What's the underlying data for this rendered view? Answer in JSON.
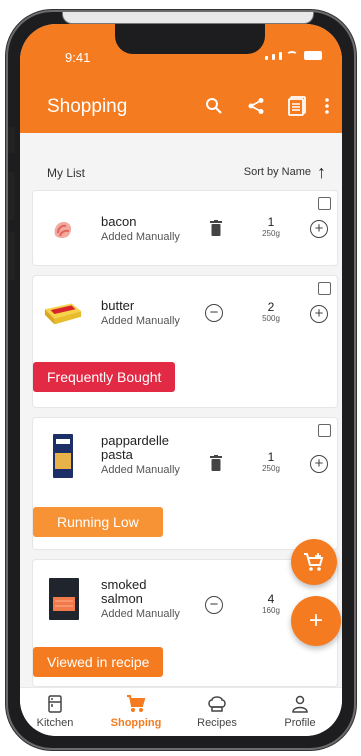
{
  "status": {
    "time": "9:41"
  },
  "app": {
    "title": "Shopping"
  },
  "list": {
    "name": "My List",
    "sort_label": "Sort by Name"
  },
  "items": [
    {
      "name": "bacon",
      "subtitle": "Added Manually",
      "quantity": "1",
      "unit": "250g",
      "tag": ""
    },
    {
      "name": "butter",
      "subtitle": "Added Manually",
      "quantity": "2",
      "unit": "500g",
      "tag": "Frequently Bought"
    },
    {
      "name": "pappardelle pasta",
      "subtitle": "Added Manually",
      "quantity": "1",
      "unit": "250g",
      "tag": "Running Low"
    },
    {
      "name": "smoked salmon",
      "subtitle": "Added Manually",
      "quantity": "4",
      "unit": "160g",
      "tag": "Viewed in recipe"
    }
  ],
  "nav": [
    {
      "label": "Kitchen",
      "icon": "kitchen-icon"
    },
    {
      "label": "Shopping",
      "icon": "cart-icon",
      "active": true
    },
    {
      "label": "Recipes",
      "icon": "chef-hat-icon"
    },
    {
      "label": "Profile",
      "icon": "person-icon"
    }
  ],
  "colors": {
    "accent": "#f47b20",
    "tag_red": "#e22a45",
    "tag_orange": "#f89335"
  }
}
